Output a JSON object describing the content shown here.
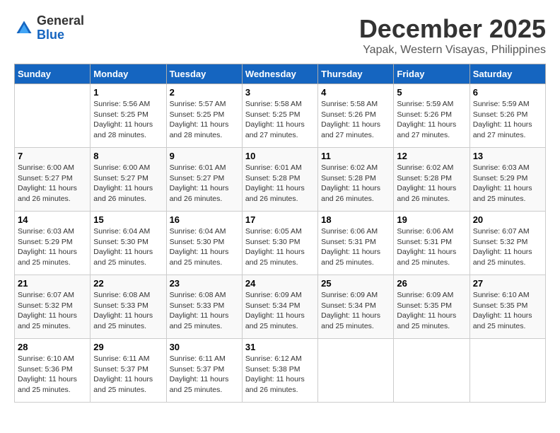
{
  "logo": {
    "general": "General",
    "blue": "Blue"
  },
  "title": "December 2025",
  "subtitle": "Yapak, Western Visayas, Philippines",
  "headers": [
    "Sunday",
    "Monday",
    "Tuesday",
    "Wednesday",
    "Thursday",
    "Friday",
    "Saturday"
  ],
  "weeks": [
    [
      {
        "day": "",
        "info": ""
      },
      {
        "day": "1",
        "info": "Sunrise: 5:56 AM\nSunset: 5:25 PM\nDaylight: 11 hours and 28 minutes."
      },
      {
        "day": "2",
        "info": "Sunrise: 5:57 AM\nSunset: 5:25 PM\nDaylight: 11 hours and 28 minutes."
      },
      {
        "day": "3",
        "info": "Sunrise: 5:58 AM\nSunset: 5:25 PM\nDaylight: 11 hours and 27 minutes."
      },
      {
        "day": "4",
        "info": "Sunrise: 5:58 AM\nSunset: 5:26 PM\nDaylight: 11 hours and 27 minutes."
      },
      {
        "day": "5",
        "info": "Sunrise: 5:59 AM\nSunset: 5:26 PM\nDaylight: 11 hours and 27 minutes."
      },
      {
        "day": "6",
        "info": "Sunrise: 5:59 AM\nSunset: 5:26 PM\nDaylight: 11 hours and 27 minutes."
      }
    ],
    [
      {
        "day": "7",
        "info": "Sunrise: 6:00 AM\nSunset: 5:27 PM\nDaylight: 11 hours and 26 minutes."
      },
      {
        "day": "8",
        "info": "Sunrise: 6:00 AM\nSunset: 5:27 PM\nDaylight: 11 hours and 26 minutes."
      },
      {
        "day": "9",
        "info": "Sunrise: 6:01 AM\nSunset: 5:27 PM\nDaylight: 11 hours and 26 minutes."
      },
      {
        "day": "10",
        "info": "Sunrise: 6:01 AM\nSunset: 5:28 PM\nDaylight: 11 hours and 26 minutes."
      },
      {
        "day": "11",
        "info": "Sunrise: 6:02 AM\nSunset: 5:28 PM\nDaylight: 11 hours and 26 minutes."
      },
      {
        "day": "12",
        "info": "Sunrise: 6:02 AM\nSunset: 5:28 PM\nDaylight: 11 hours and 26 minutes."
      },
      {
        "day": "13",
        "info": "Sunrise: 6:03 AM\nSunset: 5:29 PM\nDaylight: 11 hours and 25 minutes."
      }
    ],
    [
      {
        "day": "14",
        "info": "Sunrise: 6:03 AM\nSunset: 5:29 PM\nDaylight: 11 hours and 25 minutes."
      },
      {
        "day": "15",
        "info": "Sunrise: 6:04 AM\nSunset: 5:30 PM\nDaylight: 11 hours and 25 minutes."
      },
      {
        "day": "16",
        "info": "Sunrise: 6:04 AM\nSunset: 5:30 PM\nDaylight: 11 hours and 25 minutes."
      },
      {
        "day": "17",
        "info": "Sunrise: 6:05 AM\nSunset: 5:30 PM\nDaylight: 11 hours and 25 minutes."
      },
      {
        "day": "18",
        "info": "Sunrise: 6:06 AM\nSunset: 5:31 PM\nDaylight: 11 hours and 25 minutes."
      },
      {
        "day": "19",
        "info": "Sunrise: 6:06 AM\nSunset: 5:31 PM\nDaylight: 11 hours and 25 minutes."
      },
      {
        "day": "20",
        "info": "Sunrise: 6:07 AM\nSunset: 5:32 PM\nDaylight: 11 hours and 25 minutes."
      }
    ],
    [
      {
        "day": "21",
        "info": "Sunrise: 6:07 AM\nSunset: 5:32 PM\nDaylight: 11 hours and 25 minutes."
      },
      {
        "day": "22",
        "info": "Sunrise: 6:08 AM\nSunset: 5:33 PM\nDaylight: 11 hours and 25 minutes."
      },
      {
        "day": "23",
        "info": "Sunrise: 6:08 AM\nSunset: 5:33 PM\nDaylight: 11 hours and 25 minutes."
      },
      {
        "day": "24",
        "info": "Sunrise: 6:09 AM\nSunset: 5:34 PM\nDaylight: 11 hours and 25 minutes."
      },
      {
        "day": "25",
        "info": "Sunrise: 6:09 AM\nSunset: 5:34 PM\nDaylight: 11 hours and 25 minutes."
      },
      {
        "day": "26",
        "info": "Sunrise: 6:09 AM\nSunset: 5:35 PM\nDaylight: 11 hours and 25 minutes."
      },
      {
        "day": "27",
        "info": "Sunrise: 6:10 AM\nSunset: 5:35 PM\nDaylight: 11 hours and 25 minutes."
      }
    ],
    [
      {
        "day": "28",
        "info": "Sunrise: 6:10 AM\nSunset: 5:36 PM\nDaylight: 11 hours and 25 minutes."
      },
      {
        "day": "29",
        "info": "Sunrise: 6:11 AM\nSunset: 5:37 PM\nDaylight: 11 hours and 25 minutes."
      },
      {
        "day": "30",
        "info": "Sunrise: 6:11 AM\nSunset: 5:37 PM\nDaylight: 11 hours and 25 minutes."
      },
      {
        "day": "31",
        "info": "Sunrise: 6:12 AM\nSunset: 5:38 PM\nDaylight: 11 hours and 26 minutes."
      },
      {
        "day": "",
        "info": ""
      },
      {
        "day": "",
        "info": ""
      },
      {
        "day": "",
        "info": ""
      }
    ]
  ]
}
